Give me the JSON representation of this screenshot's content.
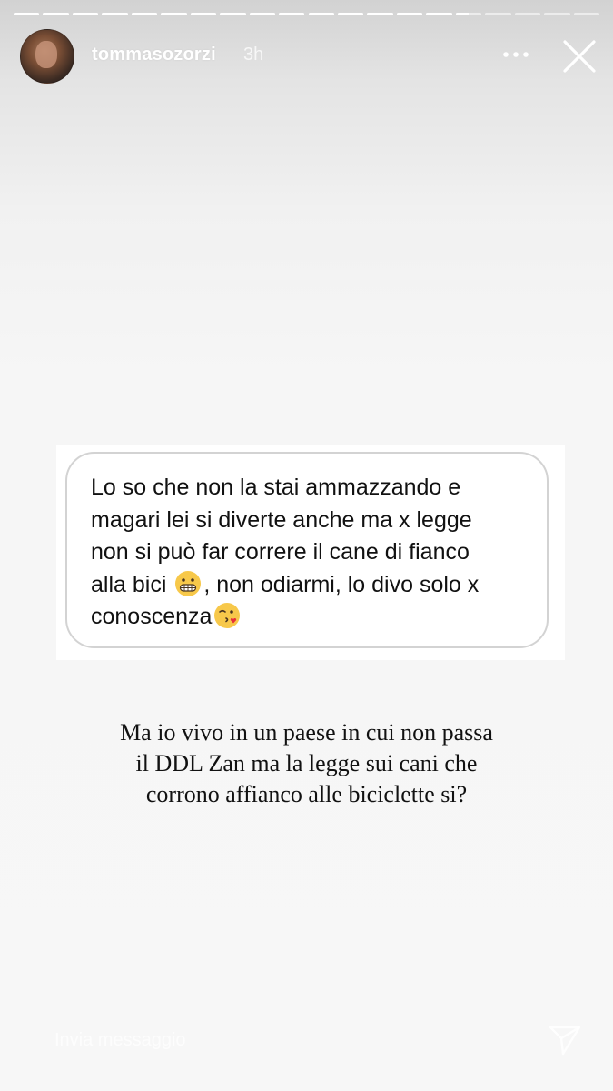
{
  "story": {
    "progress": {
      "segments_total": 20,
      "current_segment": 16,
      "current_fraction": 0.5
    },
    "header": {
      "username": "tommasozorzi",
      "time_ago": "3h"
    },
    "question_sticker": {
      "line1": "Lo so che non la stai ammazzando e",
      "line2": "magari lei si diverte anche ma x legge",
      "line3": "non si può far correre il cane di fianco",
      "line4a": "alla bici",
      "line4b": ", non odiarmi, lo divo solo x",
      "line5": "conoscenza",
      "emoji1": "grimacing-face-emoji",
      "emoji2": "face-blowing-kiss-emoji"
    },
    "answer_text": "Ma io vivo in un paese in cui non passa\nil DDL Zan ma la legge sui cani che\ncorrono affianco alle biciclette si?",
    "footer": {
      "reply_placeholder": "Invia messaggio",
      "send_icon": "paper-plane-icon"
    }
  },
  "colors": {
    "card_border": "#d3d3d3",
    "text": "#111111",
    "header_text": "#ffffff"
  }
}
